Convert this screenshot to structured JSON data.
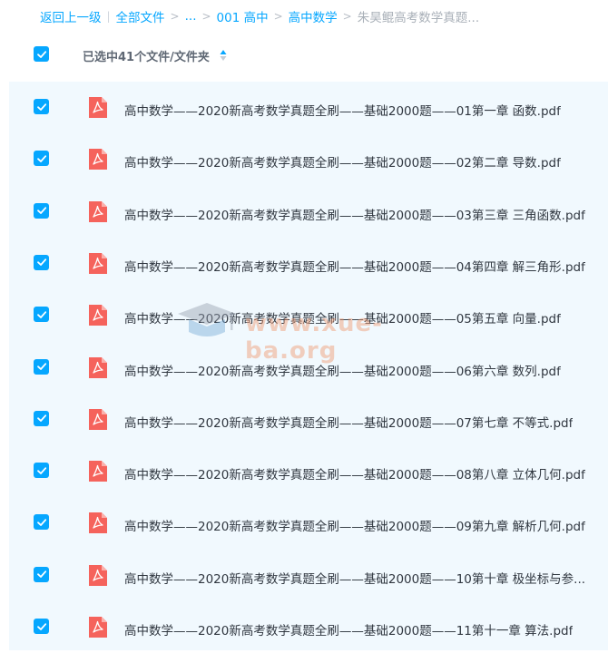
{
  "breadcrumb": {
    "back": "返回上一级",
    "items": [
      "全部文件",
      "...",
      "001 高中",
      "高中数学"
    ],
    "current": "朱昊鲲高考数学真题..."
  },
  "header": {
    "selected_label": "已选中41个文件/文件夹"
  },
  "files": [
    "高中数学——2020新高考数学真题全刷——基础2000题——01第一章 函数.pdf",
    "高中数学——2020新高考数学真题全刷——基础2000题——02第二章 导数.pdf",
    "高中数学——2020新高考数学真题全刷——基础2000题——03第三章 三角函数.pdf",
    "高中数学——2020新高考数学真题全刷——基础2000题——04第四章 解三角形.pdf",
    "高中数学——2020新高考数学真题全刷——基础2000题——05第五章 向量.pdf",
    "高中数学——2020新高考数学真题全刷——基础2000题——06第六章 数列.pdf",
    "高中数学——2020新高考数学真题全刷——基础2000题——07第七章 不等式.pdf",
    "高中数学——2020新高考数学真题全刷——基础2000题——08第八章 立体几何.pdf",
    "高中数学——2020新高考数学真题全刷——基础2000题——09第九章 解析几何.pdf",
    "高中数学——2020新高考数学真题全刷——基础2000题——10第十章 极坐标与参...",
    "高中数学——2020新高考数学真题全刷——基础2000题——11第十一章 算法.pdf"
  ],
  "watermark": "www.xue-ba.org",
  "colors": {
    "accent": "#06a7ff",
    "row_bg": "#f1f9fe",
    "pdf_icon": "#f5635c"
  }
}
